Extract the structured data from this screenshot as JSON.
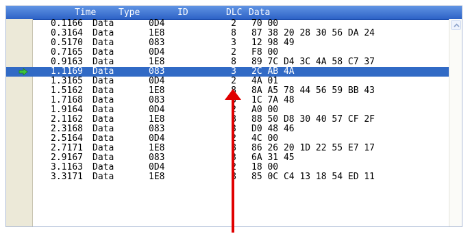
{
  "table": {
    "columns": {
      "time": "Time",
      "type": "Type",
      "id": "ID",
      "dlc": "DLC",
      "data": "Data"
    },
    "selected_index": 5,
    "rows": [
      {
        "time": "0.1166",
        "type": "Data",
        "id": "0D4",
        "dlc": "2",
        "data": "70 00"
      },
      {
        "time": "0.3164",
        "type": "Data",
        "id": "1E8",
        "dlc": "8",
        "data": "87 38 20 28 30 56 DA 24"
      },
      {
        "time": "0.5170",
        "type": "Data",
        "id": "083",
        "dlc": "3",
        "data": "12 98 49"
      },
      {
        "time": "0.7165",
        "type": "Data",
        "id": "0D4",
        "dlc": "2",
        "data": "F8 00"
      },
      {
        "time": "0.9163",
        "type": "Data",
        "id": "1E8",
        "dlc": "8",
        "data": "89 7C D4 3C 4A 58 C7 37"
      },
      {
        "time": "1.1169",
        "type": "Data",
        "id": "083",
        "dlc": "3",
        "data": "2C AB 4A"
      },
      {
        "time": "1.3165",
        "type": "Data",
        "id": "0D4",
        "dlc": "2",
        "data": "4A 01"
      },
      {
        "time": "1.5162",
        "type": "Data",
        "id": "1E8",
        "dlc": "8",
        "data": "8A A5 78 44 56 59 BB 43"
      },
      {
        "time": "1.7168",
        "type": "Data",
        "id": "083",
        "dlc": "3",
        "data": "1C 7A 48"
      },
      {
        "time": "1.9164",
        "type": "Data",
        "id": "0D4",
        "dlc": "2",
        "data": "A0 00"
      },
      {
        "time": "2.1162",
        "type": "Data",
        "id": "1E8",
        "dlc": "8",
        "data": "88 50 D8 30 40 57 CF 2F"
      },
      {
        "time": "2.3168",
        "type": "Data",
        "id": "083",
        "dlc": "3",
        "data": "D0 48 46"
      },
      {
        "time": "2.5164",
        "type": "Data",
        "id": "0D4",
        "dlc": "2",
        "data": "4C 00"
      },
      {
        "time": "2.7171",
        "type": "Data",
        "id": "1E8",
        "dlc": "8",
        "data": "86 26 20 1D 22 55 E7 17"
      },
      {
        "time": "2.9167",
        "type": "Data",
        "id": "083",
        "dlc": "3",
        "data": "6A 31 45"
      },
      {
        "time": "3.1163",
        "type": "Data",
        "id": "0D4",
        "dlc": "2",
        "data": "18 00"
      },
      {
        "time": "3.3171",
        "type": "Data",
        "id": "1E8",
        "dlc": "8",
        "data": "85 0C C4 13 18 54 ED 11"
      }
    ]
  },
  "icons": {
    "row_marker": "green-arrow-right-icon",
    "scroll_up": "chevron-up-icon",
    "annotation": "red-arrow-up-icon"
  },
  "colors": {
    "header_bg": "#2d62c6",
    "selection_bg": "#316ac5",
    "marker": "#3cc43c",
    "annotation": "#e00000"
  }
}
